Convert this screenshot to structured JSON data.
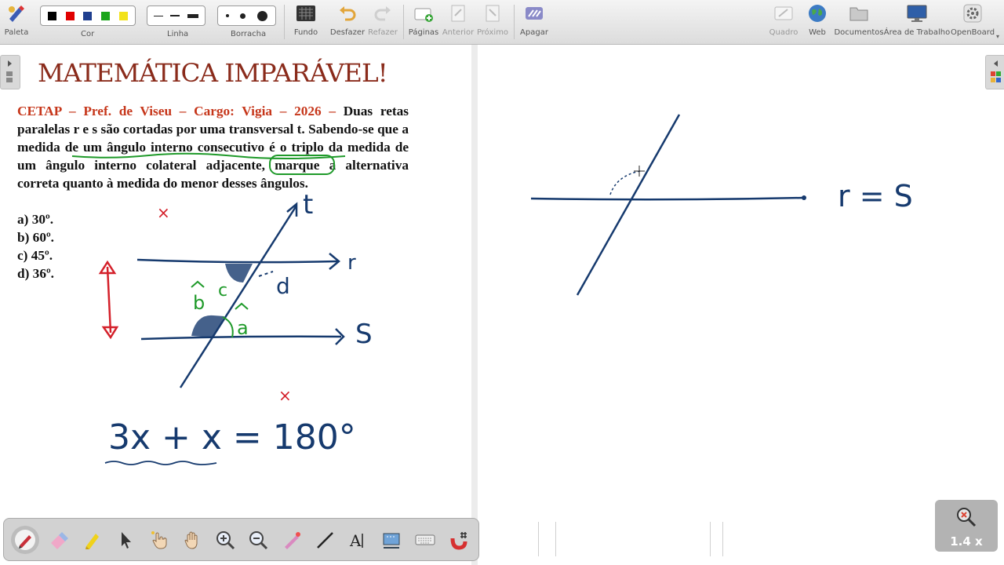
{
  "toolbar": {
    "palette_label": "Paleta",
    "color_label": "Cor",
    "line_label": "Linha",
    "eraser_label": "Borracha",
    "background_label": "Fundo",
    "undo_label": "Desfazer",
    "redo_label": "Refazer",
    "pages_label": "Páginas",
    "previous_label": "Anterior",
    "next_label": "Próximo",
    "clear_label": "Apagar",
    "board_label": "Quadro",
    "web_label": "Web",
    "documents_label": "Documentos",
    "desktop_label": "Área de Trabalho",
    "openboard_label": "OpenBoard",
    "colors": [
      "#000000",
      "#e00000",
      "#1f3f8f",
      "#1aa51a",
      "#f2e21a"
    ]
  },
  "document": {
    "title": "MATEMÁTICA IMPARÁVEL!",
    "question_source": "CETAP – Pref. de Viseu – Cargo: Vigia – 2026 –",
    "question_text": "Duas retas paralelas r e s são cortadas por uma transversal t. Sabendo-se que a medida de um ângulo interno consecutivo é o triplo da medida de um ângulo interno colateral adjacente, marque a alternativa correta quanto à medida do menor desses ângulos.",
    "options": [
      "a) 30º.",
      "b) 60º.",
      "c) 45º.",
      "d) 36º."
    ]
  },
  "handwriting": {
    "label_t": "t",
    "label_r": "r",
    "label_s": "S",
    "label_b": "b",
    "label_c": "c",
    "label_d": "d",
    "label_a": "a",
    "equation": "3x + x = 180°",
    "right_note": "r = S",
    "cross_mark": "×"
  },
  "zoom": {
    "label": "1.4 x"
  },
  "theme": {
    "title_color": "#8a2b1b",
    "source_color": "#c6361a",
    "ink_blue": "#163a6e",
    "ink_green": "#1f9a2a",
    "ink_red": "#d4202a"
  }
}
